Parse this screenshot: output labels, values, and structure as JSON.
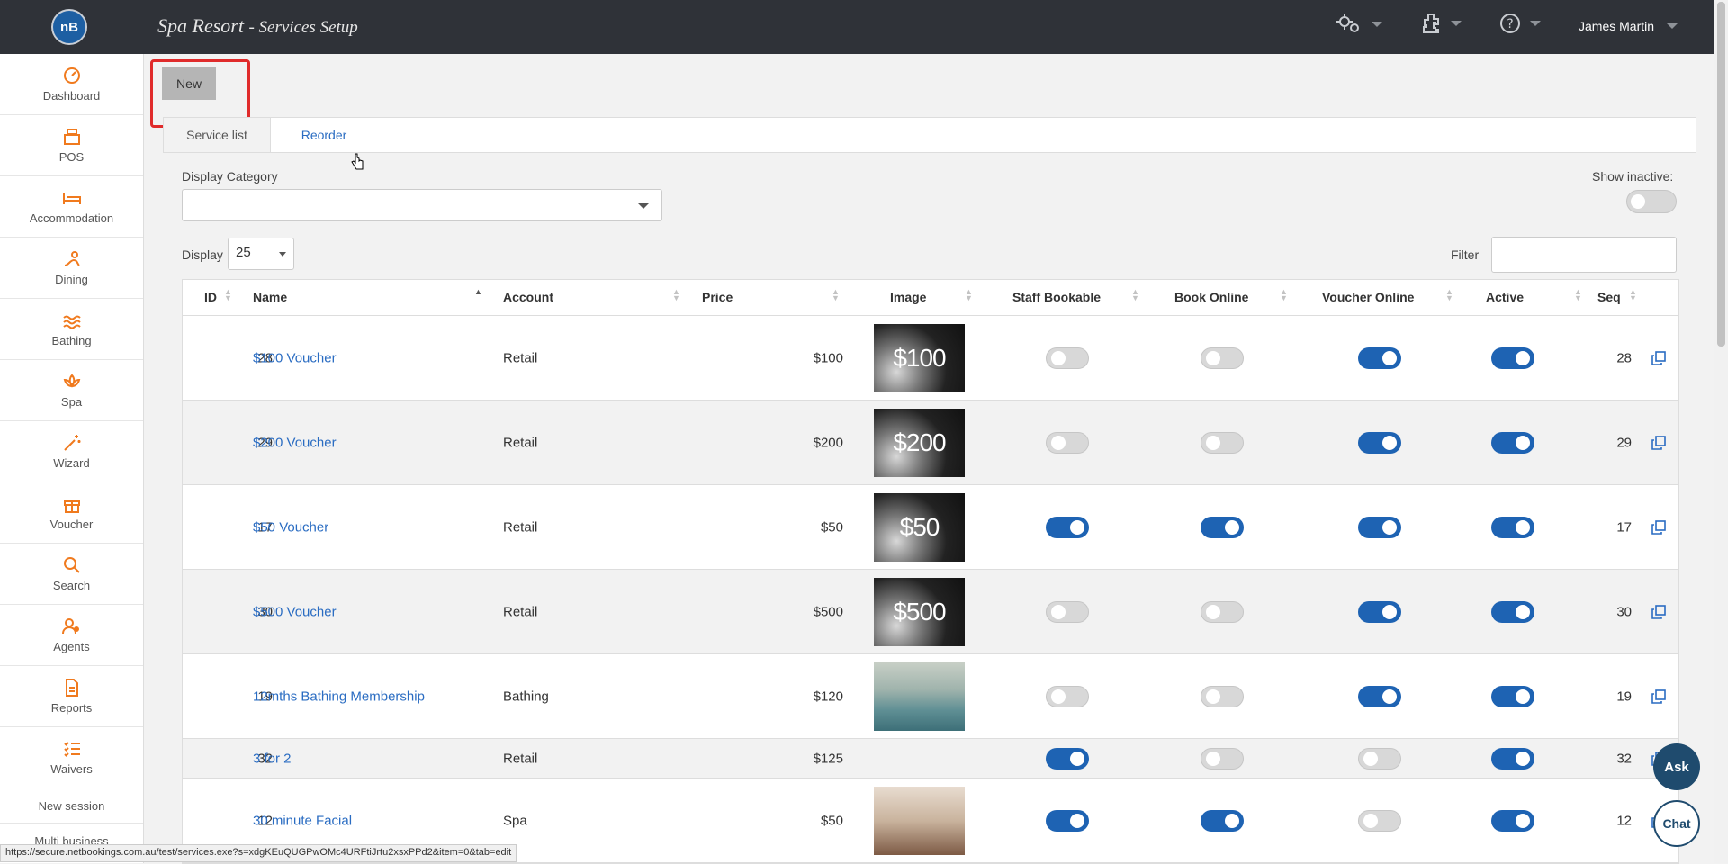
{
  "header": {
    "logo_text": "nB",
    "title": "Spa Resort",
    "subtitle": "- Services Setup",
    "user_name": "James Martin",
    "icons": [
      "settings-gears-icon",
      "plugin-icon",
      "help-icon"
    ]
  },
  "sidebar": {
    "items": [
      {
        "label": "Dashboard",
        "icon": "dashboard-icon"
      },
      {
        "label": "POS",
        "icon": "cash-register-icon"
      },
      {
        "label": "Accommodation",
        "icon": "bed-icon"
      },
      {
        "label": "Dining",
        "icon": "dining-icon"
      },
      {
        "label": "Bathing",
        "icon": "waves-icon"
      },
      {
        "label": "Spa",
        "icon": "lotus-icon"
      },
      {
        "label": "Wizard",
        "icon": "magic-wand-icon"
      },
      {
        "label": "Voucher",
        "icon": "gift-icon"
      },
      {
        "label": "Search",
        "icon": "search-icon"
      },
      {
        "label": "Agents",
        "icon": "agents-icon"
      },
      {
        "label": "Reports",
        "icon": "report-icon"
      },
      {
        "label": "Waivers",
        "icon": "list-icon"
      }
    ],
    "new_session": "New session",
    "multi_business": "Multi business"
  },
  "toolbar": {
    "new_label": "New"
  },
  "tabs": {
    "service_list": "Service list",
    "reorder": "Reorder"
  },
  "filters": {
    "display_category_label": "Display Category",
    "display_category_value": "",
    "show_inactive_label": "Show inactive:",
    "show_inactive": false,
    "display_label": "Display",
    "display_value": "25",
    "filter_label": "Filter",
    "filter_value": ""
  },
  "table": {
    "columns": [
      "ID",
      "Name",
      "Account",
      "Price",
      "Image",
      "Staff Bookable",
      "Book Online",
      "Voucher Online",
      "Active",
      "Seq"
    ],
    "rows": [
      {
        "id": "28",
        "name": "$100 Voucher",
        "account": "Retail",
        "price": "$100",
        "image": "voucher",
        "image_text": "$100",
        "staff_bookable": false,
        "book_online": false,
        "voucher_online": true,
        "active": true,
        "seq": "28"
      },
      {
        "id": "29",
        "name": "$200 Voucher",
        "account": "Retail",
        "price": "$200",
        "image": "voucher",
        "image_text": "$200",
        "staff_bookable": false,
        "book_online": false,
        "voucher_online": true,
        "active": true,
        "seq": "29"
      },
      {
        "id": "17",
        "name": "$50 Voucher",
        "account": "Retail",
        "price": "$50",
        "image": "voucher",
        "image_text": "$50",
        "staff_bookable": true,
        "book_online": true,
        "voucher_online": true,
        "active": true,
        "seq": "17"
      },
      {
        "id": "30",
        "name": "$500 Voucher",
        "account": "Retail",
        "price": "$500",
        "image": "voucher",
        "image_text": "$500",
        "staff_bookable": false,
        "book_online": false,
        "voucher_online": true,
        "active": true,
        "seq": "30"
      },
      {
        "id": "19",
        "name": "12mths Bathing Membership",
        "account": "Bathing",
        "price": "$120",
        "image": "bath",
        "image_text": "",
        "staff_bookable": false,
        "book_online": false,
        "voucher_online": true,
        "active": true,
        "seq": "19"
      },
      {
        "id": "32",
        "name": "3 for 2",
        "account": "Retail",
        "price": "$125",
        "image": "",
        "image_text": "",
        "staff_bookable": true,
        "book_online": false,
        "voucher_online": false,
        "active": true,
        "seq": "32"
      },
      {
        "id": "12",
        "name": "30 minute Facial",
        "account": "Spa",
        "price": "$50",
        "image": "facial",
        "image_text": "",
        "staff_bookable": true,
        "book_online": true,
        "voucher_online": false,
        "active": true,
        "seq": "12"
      }
    ]
  },
  "floating": {
    "ask": "Ask",
    "chat": "Chat"
  },
  "status_url": "https://secure.netbookings.com.au/test/services.exe?s=xdgKEuQUGPwOMc4URFtiJrtu2xsxPPd2&item=0&tab=edit",
  "colors": {
    "accent": "#1e63b3",
    "topbar": "#2f3238",
    "sidebar_icon": "#f07a1e",
    "highlight": "#e02b2b"
  }
}
